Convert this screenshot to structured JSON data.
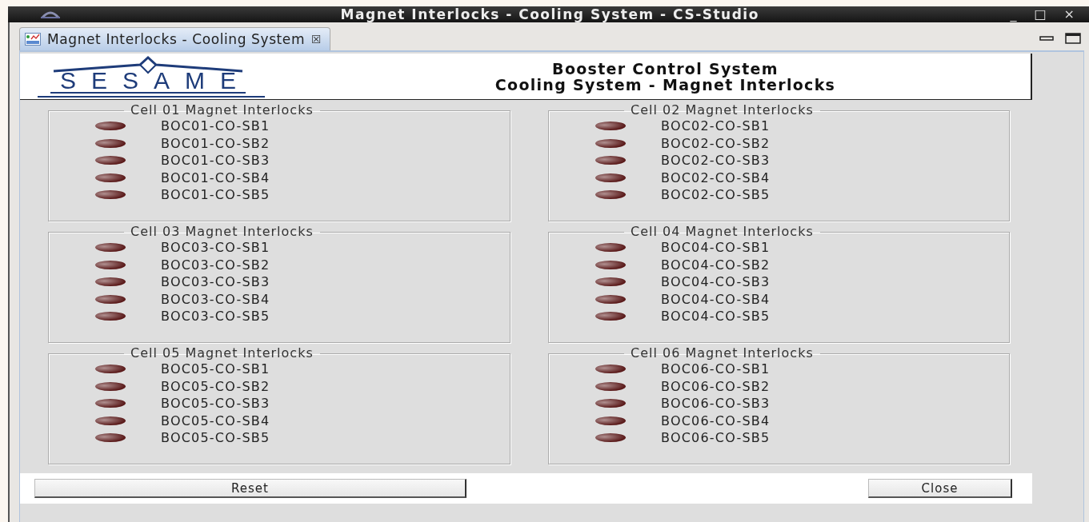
{
  "window": {
    "title": "Magnet Interlocks - Cooling System - CS-Studio",
    "controls": [
      "_",
      "□",
      "×"
    ]
  },
  "tab": {
    "label": "Magnet Interlocks - Cooling System",
    "close": "☒",
    "selected": true
  },
  "header": {
    "logo": "SESAME",
    "title_lines": [
      "Booster Control System",
      "Cooling System - Magnet Interlocks"
    ]
  },
  "groups": [
    {
      "title": "Cell 01 Magnet Interlocks",
      "items": [
        {
          "label": "BOC01-CO-SB1",
          "on": false
        },
        {
          "label": "BOC01-CO-SB2",
          "on": false
        },
        {
          "label": "BOC01-CO-SB3",
          "on": false
        },
        {
          "label": "BOC01-CO-SB4",
          "on": false
        },
        {
          "label": "BOC01-CO-SB5",
          "on": false
        }
      ]
    },
    {
      "title": "Cell 02 Magnet Interlocks",
      "items": [
        {
          "label": "BOC02-CO-SB1",
          "on": false
        },
        {
          "label": "BOC02-CO-SB2",
          "on": false
        },
        {
          "label": "BOC02-CO-SB3",
          "on": false
        },
        {
          "label": "BOC02-CO-SB4",
          "on": false
        },
        {
          "label": "BOC02-CO-SB5",
          "on": false
        }
      ]
    },
    {
      "title": "Cell 03 Magnet Interlocks",
      "items": [
        {
          "label": "BOC03-CO-SB1",
          "on": false
        },
        {
          "label": "BOC03-CO-SB2",
          "on": false
        },
        {
          "label": "BOC03-CO-SB3",
          "on": false
        },
        {
          "label": "BOC03-CO-SB4",
          "on": false
        },
        {
          "label": "BOC03-CO-SB5",
          "on": false
        }
      ]
    },
    {
      "title": "Cell 04 Magnet Interlocks",
      "items": [
        {
          "label": "BOC04-CO-SB1",
          "on": false
        },
        {
          "label": "BOC04-CO-SB2",
          "on": false
        },
        {
          "label": "BOC04-CO-SB3",
          "on": false
        },
        {
          "label": "BOC04-CO-SB4",
          "on": false
        },
        {
          "label": "BOC04-CO-SB5",
          "on": false
        }
      ]
    },
    {
      "title": "Cell 05 Magnet Interlocks",
      "items": [
        {
          "label": "BOC05-CO-SB1",
          "on": false
        },
        {
          "label": "BOC05-CO-SB2",
          "on": false
        },
        {
          "label": "BOC05-CO-SB3",
          "on": false
        },
        {
          "label": "BOC05-CO-SB4",
          "on": false
        },
        {
          "label": "BOC05-CO-SB5",
          "on": false
        }
      ]
    },
    {
      "title": "Cell 06 Magnet Interlocks",
      "items": [
        {
          "label": "BOC06-CO-SB1",
          "on": false
        },
        {
          "label": "BOC06-CO-SB2",
          "on": false
        },
        {
          "label": "BOC06-CO-SB3",
          "on": false
        },
        {
          "label": "BOC06-CO-SB4",
          "on": false
        },
        {
          "label": "BOC06-CO-SB5",
          "on": false
        }
      ]
    }
  ],
  "buttons": [
    "Reset",
    "Close"
  ]
}
